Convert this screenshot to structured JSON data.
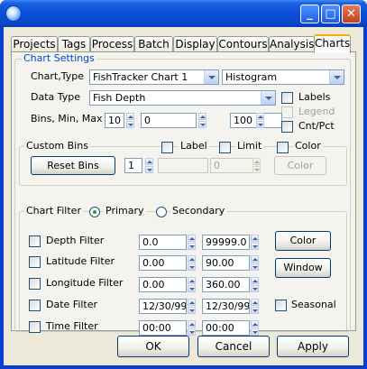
{
  "window": {
    "app_icon": "app-globe-icon",
    "controls": {
      "minimize": "_",
      "maximize": "□",
      "close": "✕"
    }
  },
  "tabs": [
    "Projects",
    "Tags",
    "Process",
    "Batch",
    "Display",
    "Contours",
    "Analysis",
    "Charts"
  ],
  "active_tab": "Charts",
  "chart_settings": {
    "group_label": "Chart Settings",
    "chart_type_label": "Chart,Type",
    "chart_select": "FishTracker Chart 1",
    "type_select": "Histogram",
    "data_type_label": "Data Type",
    "data_type_select": "Fish Depth",
    "bins_label": "Bins, Min, Max",
    "bins": "10",
    "min": "0",
    "max": "100",
    "labels_label": "Labels",
    "legend_label": "Legend",
    "cntpct_label": "Cnt/Pct"
  },
  "custom_bins": {
    "group_label": "Custom Bins",
    "label_label": "Label",
    "limit_label": "Limit",
    "color_label": "Color",
    "reset_button": "Reset Bins",
    "bin_index": "1",
    "bin_label_value": "",
    "bin_limit_value": "0",
    "color_button": "Color"
  },
  "chart_filter": {
    "group_label": "Chart Filter",
    "primary_label": "Primary",
    "secondary_label": "Secondary",
    "filters": [
      {
        "label": "Depth Filter",
        "from": "0.0",
        "to": "99999.0"
      },
      {
        "label": "Latitude Filter",
        "from": "0.00",
        "to": "90.00"
      },
      {
        "label": "Longitude Filter",
        "from": "0.00",
        "to": "360.00"
      },
      {
        "label": "Date Filter",
        "from": "12/30/99",
        "to": "12/30/99"
      },
      {
        "label": "Time Filter",
        "from": "00:00",
        "to": "00:00"
      }
    ],
    "color_button": "Color",
    "window_button": "Window",
    "seasonal_label": "Seasonal"
  },
  "buttons": {
    "ok": "OK",
    "cancel": "Cancel",
    "apply": "Apply"
  }
}
